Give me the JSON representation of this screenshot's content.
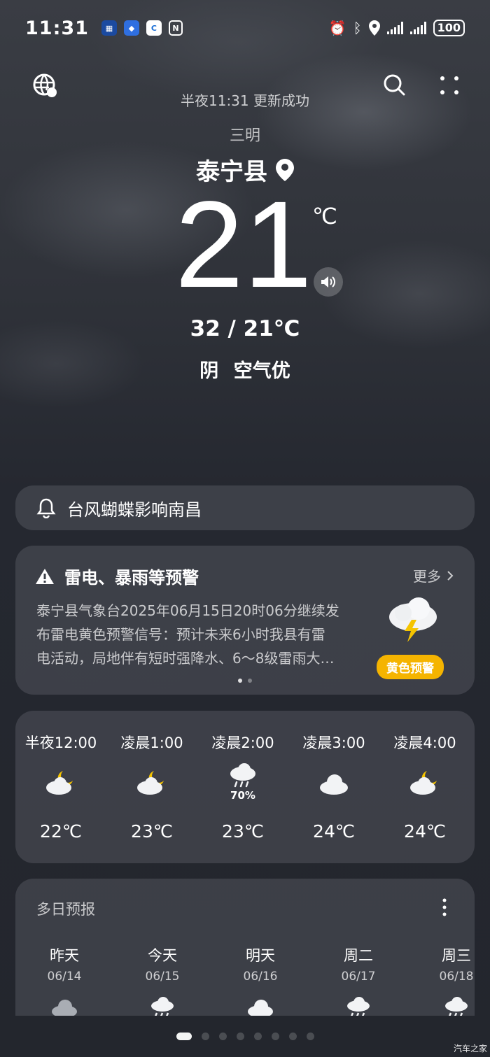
{
  "status_bar": {
    "time": "11:31",
    "battery": "100"
  },
  "header": {
    "update_text": "半夜11:31 更新成功",
    "city": "三明",
    "county": "泰宁县"
  },
  "current": {
    "temperature": "21",
    "unit": "℃",
    "high_low": "32 / 21℃",
    "condition": "阴",
    "air_quality": "空气优"
  },
  "typhoon": {
    "text": "台风蝴蝶影响南昌"
  },
  "alert": {
    "title": "雷电、暴雨等预警",
    "more_label": "更多",
    "lines": [
      "泰宁县气象台2025年06月15日20时06分继续发",
      "布雷电黄色预警信号：预计未来6小时我县有雷",
      "电活动，局地伴有短时强降水、6～8级雷雨大…"
    ],
    "badge": "黄色预警",
    "badge_color": "#f5b400"
  },
  "hourly": [
    {
      "time": "半夜12:00",
      "icon": "cloud-moon-icon",
      "precip": "",
      "temp": "22℃"
    },
    {
      "time": "凌晨1:00",
      "icon": "cloud-moon-icon",
      "precip": "",
      "temp": "23℃"
    },
    {
      "time": "凌晨2:00",
      "icon": "rain-cloud-icon",
      "precip": "70%",
      "temp": "23℃"
    },
    {
      "time": "凌晨3:00",
      "icon": "cloud-icon",
      "precip": "",
      "temp": "24℃"
    },
    {
      "time": "凌晨4:00",
      "icon": "cloud-moon-icon",
      "precip": "",
      "temp": "24℃"
    }
  ],
  "daily": {
    "title": "多日预报",
    "days": [
      {
        "name": "昨天",
        "date": "06/14",
        "icon": "cloud-icon"
      },
      {
        "name": "今天",
        "date": "06/15",
        "icon": "rain-cloud-icon"
      },
      {
        "name": "明天",
        "date": "06/16",
        "icon": "cloud-icon"
      },
      {
        "name": "周二",
        "date": "06/17",
        "icon": "rain-cloud-icon"
      },
      {
        "name": "周三",
        "date": "06/18",
        "icon": "rain-cloud-icon"
      }
    ]
  },
  "watermark": "汽车之家"
}
